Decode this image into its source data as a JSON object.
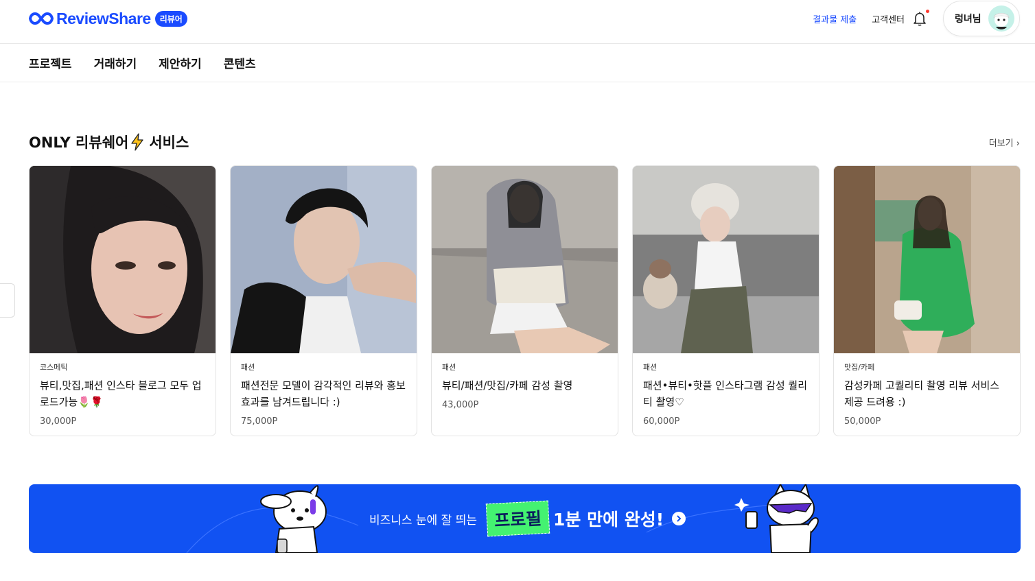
{
  "header": {
    "logo_text": "ReviewShare",
    "logo_badge": "리뷰어",
    "submit_link": "결과물 제출",
    "support_link": "고객센터",
    "profile_name": "렁녀님",
    "icons": [
      "logo-infinity-icon",
      "bell-icon",
      "avatar"
    ]
  },
  "nav": {
    "items": [
      {
        "label": "프로젝트"
      },
      {
        "label": "거래하기"
      },
      {
        "label": "제안하기"
      },
      {
        "label": "콘텐츠"
      }
    ]
  },
  "section": {
    "title_prefix": "ONLY 리뷰쉐어",
    "title_suffix": "서비스",
    "more_label": "더보기"
  },
  "cards": [
    {
      "category": "코스메틱",
      "title": "뷰티,맛집,패션 인스타 블로그 모두 업로드가능🌷🌹",
      "price": "30,000P"
    },
    {
      "category": "패션",
      "title": "패션전문 모델이 감각적인 리뷰와 홍보효과를 남겨드립니다 :)",
      "price": "75,000P"
    },
    {
      "category": "패션",
      "title": "뷰티/패션/맛집/카페 감성 촬영",
      "price": "43,000P"
    },
    {
      "category": "패션",
      "title": "패션•뷰티•핫플 인스타그램 감성 퀄리티 촬영♡",
      "price": "60,000P"
    },
    {
      "category": "맛집/카페",
      "title": "감성카페 고퀄리티 촬영 리뷰 서비스 제공 드려용 :)",
      "price": "50,000P"
    }
  ],
  "banner": {
    "sub_text": "비즈니스 눈에 잘 띄는",
    "tag_text": "프로필",
    "main_text": "1분 만에 완성!"
  },
  "colors": {
    "brand": "#1a4bff",
    "banner_bg": "#1152f2",
    "tag_green": "#44f271",
    "notification_dot": "#ff3b30"
  }
}
